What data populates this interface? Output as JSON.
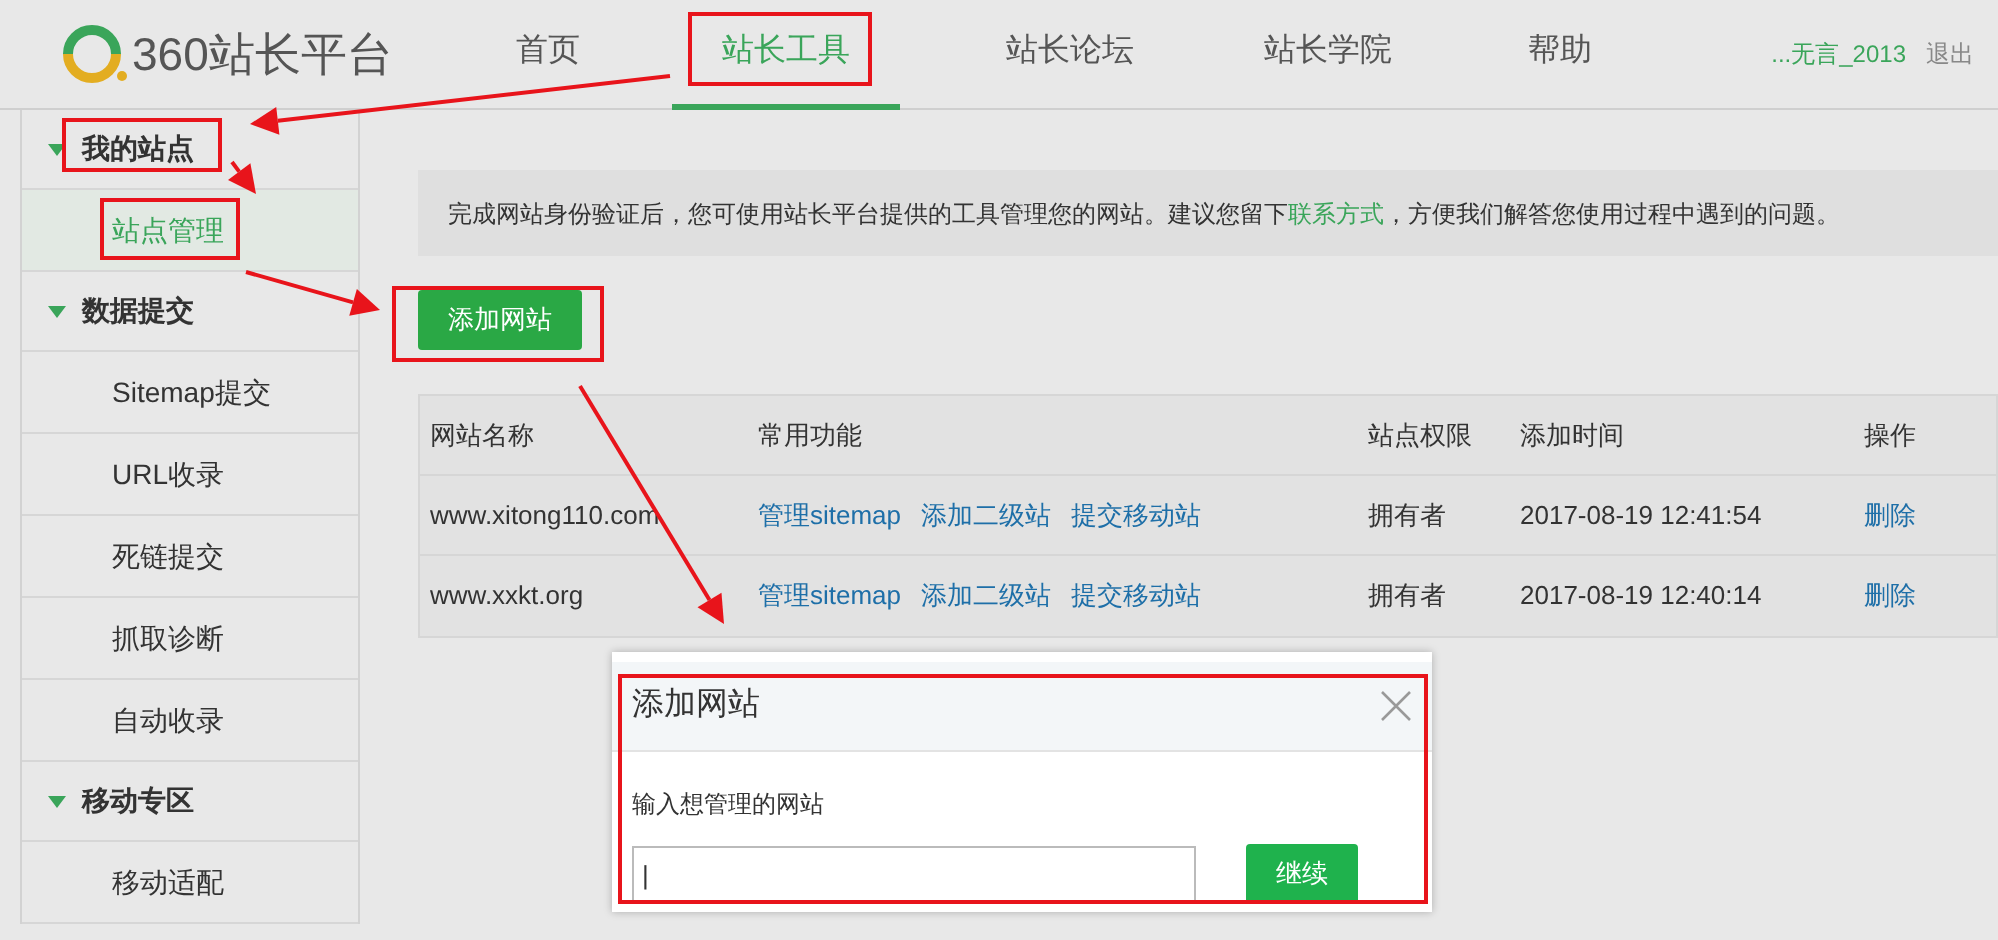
{
  "header": {
    "logo_text": "360站长平台",
    "nav": [
      {
        "label": "首页",
        "selected": false
      },
      {
        "label": "站长工具",
        "selected": true
      },
      {
        "label": "站长论坛",
        "selected": false
      },
      {
        "label": "站长学院",
        "selected": false
      },
      {
        "label": "帮助",
        "selected": false
      }
    ],
    "user": "...无言_2013",
    "logout": "退出"
  },
  "sidebar": {
    "groups": [
      {
        "label": "我的站点",
        "expanded": true,
        "children": [
          {
            "label": "站点管理",
            "selected": true
          }
        ]
      },
      {
        "label": "数据提交",
        "expanded": true,
        "children": [
          {
            "label": "Sitemap提交",
            "selected": false
          },
          {
            "label": "URL收录",
            "selected": false
          },
          {
            "label": "死链提交",
            "selected": false
          },
          {
            "label": "抓取诊断",
            "selected": false
          },
          {
            "label": "自动收录",
            "selected": false
          }
        ]
      },
      {
        "label": "移动专区",
        "expanded": true,
        "children": [
          {
            "label": "移动适配",
            "selected": false
          }
        ]
      }
    ]
  },
  "notice": {
    "before": "完成网站身份验证后，您可使用站长平台提供的工具管理您的网站。建议您留下",
    "link": "联系方式",
    "after": "，方便我们解答您使用过程中遇到的问题。"
  },
  "add_button": "添加网站",
  "table": {
    "columns": [
      "网站名称",
      "常用功能",
      "站点权限",
      "添加时间",
      "操作"
    ],
    "rows": [
      {
        "name": "www.xitong110.com",
        "functions": [
          "管理sitemap",
          "添加二级站",
          "提交移动站"
        ],
        "permission": "拥有者",
        "time": "2017-08-19 12:41:54",
        "action": "删除"
      },
      {
        "name": "www.xxkt.org",
        "functions": [
          "管理sitemap",
          "添加二级站",
          "提交移动站"
        ],
        "permission": "拥有者",
        "time": "2017-08-19 12:40:14",
        "action": "删除"
      }
    ]
  },
  "dialog": {
    "title": "添加网站",
    "label": "输入想管理的网站",
    "input_value": "|",
    "button": "继续"
  }
}
